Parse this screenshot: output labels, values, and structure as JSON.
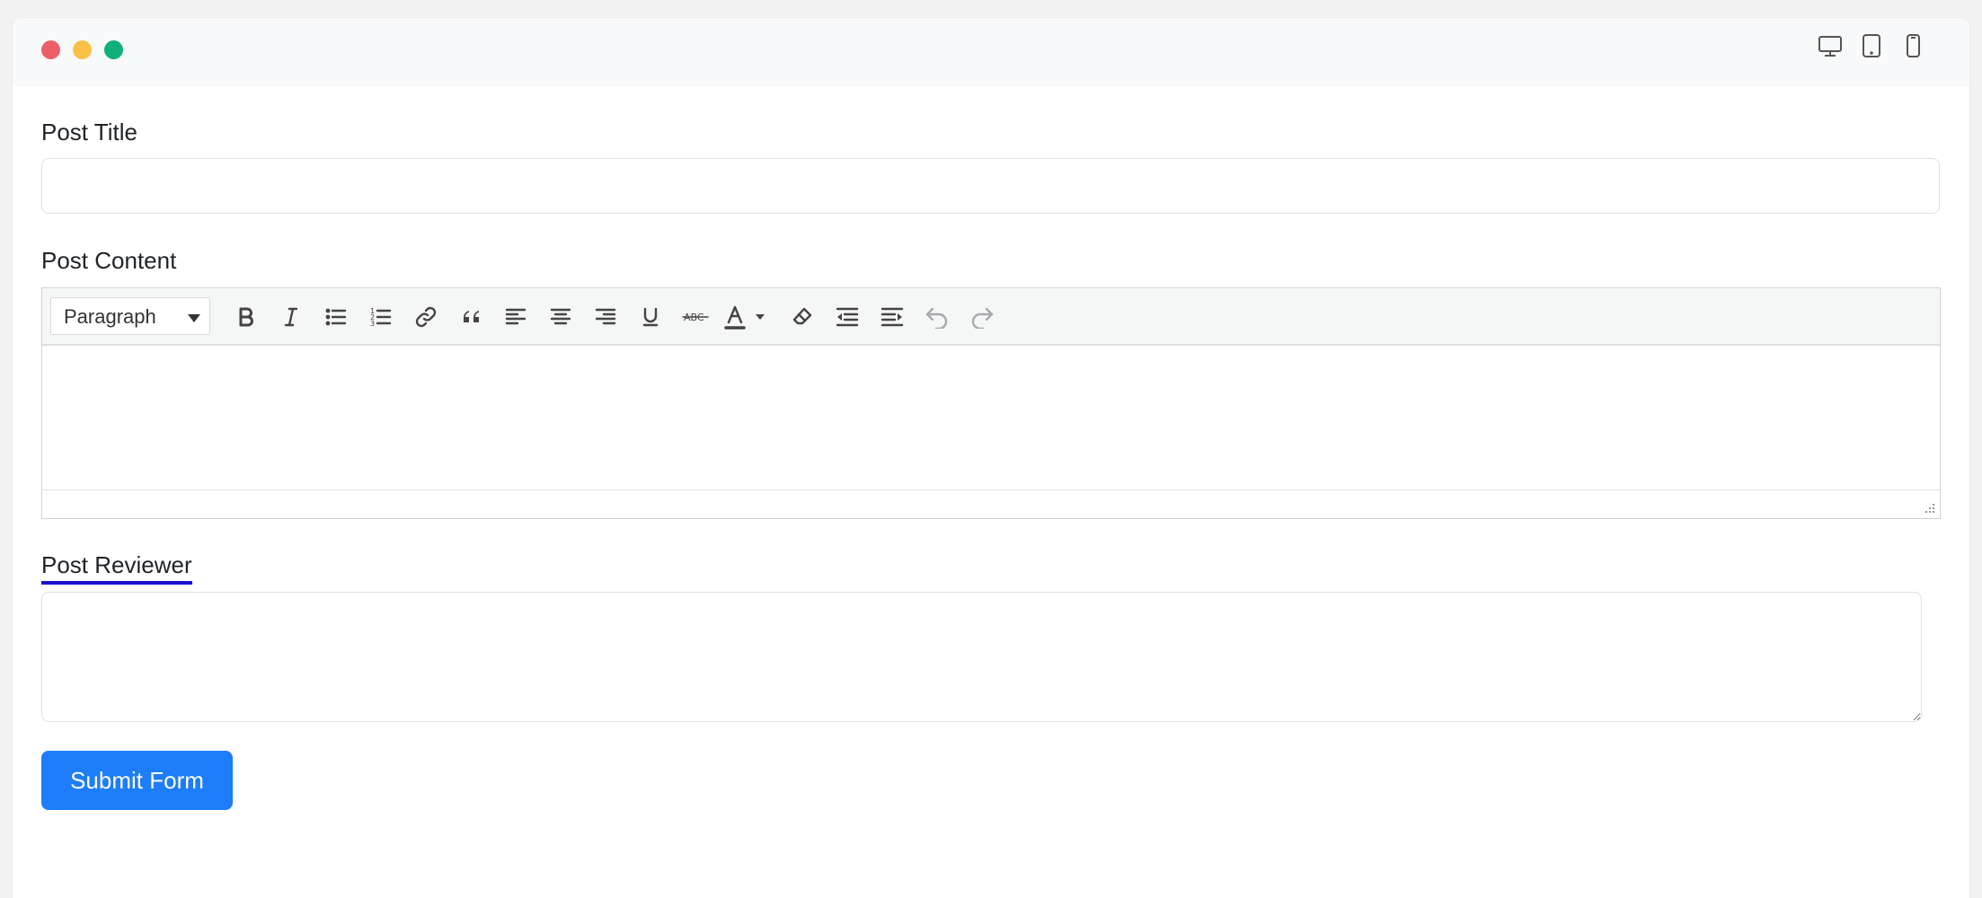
{
  "window": {
    "device_views": [
      "desktop-icon",
      "tablet-icon",
      "mobile-icon"
    ]
  },
  "form": {
    "title_label": "Post Title",
    "title_value": "",
    "content_label": "Post Content",
    "reviewer_label": "Post Reviewer",
    "reviewer_value": "",
    "submit_label": "Submit Form"
  },
  "editor": {
    "format_select": "Paragraph",
    "toolbar_icons": [
      "bold-icon",
      "italic-icon",
      "bullet-list-icon",
      "numbered-list-icon",
      "link-icon",
      "blockquote-icon",
      "align-left-icon",
      "align-center-icon",
      "align-right-icon",
      "underline-icon",
      "strikethrough-icon",
      "text-color-icon",
      "clear-formatting-icon",
      "outdent-icon",
      "indent-icon",
      "undo-icon",
      "redo-icon"
    ],
    "content": ""
  },
  "colors": {
    "accent": "#1d7dfa",
    "reviewer_underline": "#1a12c9",
    "dot_red": "#ec5f67",
    "dot_yellow": "#f8c146",
    "dot_green": "#11b07a"
  }
}
